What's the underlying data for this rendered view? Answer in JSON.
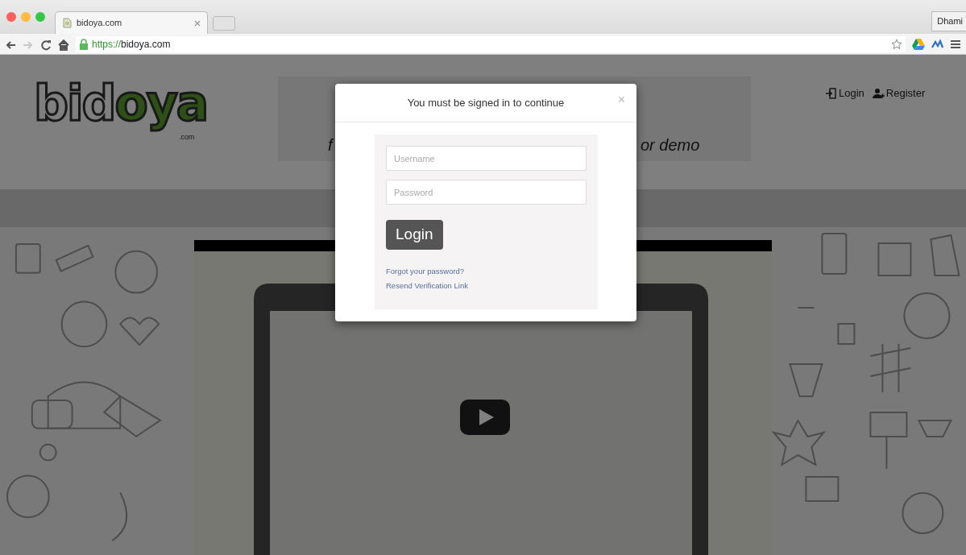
{
  "browser": {
    "tabs": [
      {
        "title": "bidoya.com",
        "selected": true
      }
    ],
    "profile": "Dhami",
    "nav_buttons": [
      {
        "kind": "back",
        "disabled": false
      },
      {
        "kind": "forward",
        "disabled": true
      },
      {
        "kind": "reload",
        "disabled": false
      },
      {
        "kind": "home",
        "disabled": false
      }
    ],
    "address": {
      "scheme": "https://",
      "host": "bidoya.com",
      "secure": true
    }
  },
  "page": {
    "logo": {
      "main": "bid",
      "accent": "oya",
      "suffix": ".com"
    },
    "banner_texts": [
      "f",
      "or demo"
    ],
    "header_links": [
      {
        "kind": "login",
        "label": "Login"
      },
      {
        "kind": "register",
        "label": "Register"
      }
    ]
  },
  "modal": {
    "title": "You must be signed in to continue",
    "close": "×",
    "fields": [
      {
        "placeholder": "Username"
      },
      {
        "placeholder": "Password"
      }
    ],
    "button": "Login",
    "links": [
      "Forgot your password?",
      "Resend Verification Link"
    ]
  }
}
